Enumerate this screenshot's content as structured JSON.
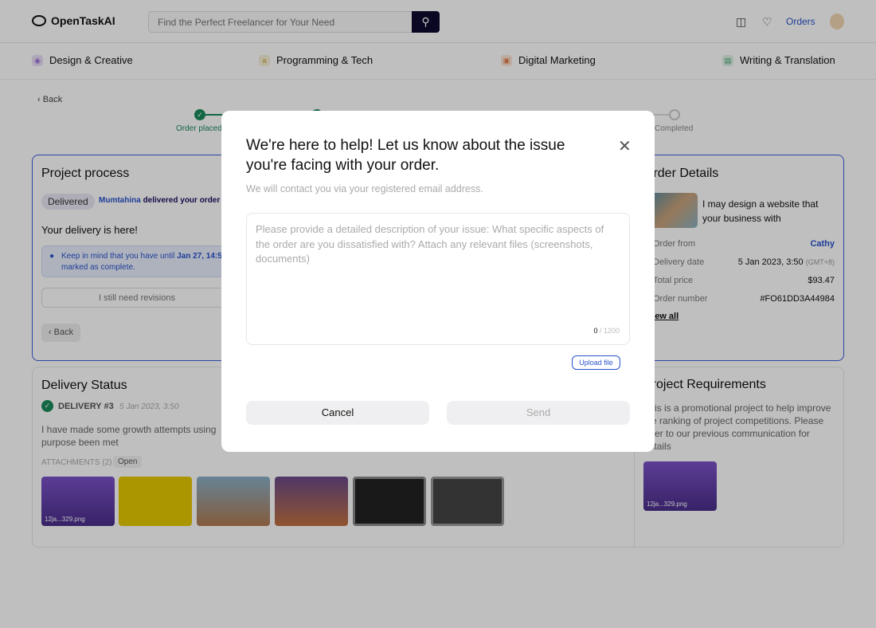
{
  "header": {
    "logo": "OpenTaskAI",
    "search_placeholder": "Find the Perfect Freelancer for Your Need",
    "orders": "Orders"
  },
  "categories": [
    {
      "label": "Design & Creative",
      "icon": "palette-icon",
      "color": "#9b6fd6"
    },
    {
      "label": "Programming & Tech",
      "icon": "code-icon",
      "color": "#c8a020"
    },
    {
      "label": "Digital Marketing",
      "icon": "briefcase-icon",
      "color": "#e07a40"
    },
    {
      "label": "Writing & Translation",
      "icon": "document-icon",
      "color": "#40a070"
    }
  ],
  "back": "Back",
  "stepper": {
    "first": "Order placed",
    "last": "Completed"
  },
  "project": {
    "title": "Project process",
    "status": "Delivered",
    "seller": "Mumtahina",
    "delivered_text": "delivered your order",
    "delivery_heading": "Your delivery is here!",
    "info_pre": "Keep in mind that you have until ",
    "info_date": "Jan 27, 14:5",
    "info_post": "marked as complete.",
    "revisions": "I still need revisions",
    "back": "Back"
  },
  "order": {
    "title": "Order Details",
    "gig": "I may design a website that your business with",
    "rows": [
      {
        "label": "Order from",
        "value": "Cathy"
      },
      {
        "label": "Delivery date",
        "value": "5 Jan 2023, 3:50",
        "suffix": "(GMT+8)"
      },
      {
        "label": "Total price",
        "value": "$93.47"
      },
      {
        "label": "Order number",
        "value": "#FO61DD3A44984"
      }
    ],
    "view_all": "View all"
  },
  "delivery": {
    "title": "Delivery Status",
    "label": "DELIVERY #3",
    "date": "5 Jan 2023, 3:50",
    "text": "I have made some growth attempts using",
    "text2": "purpose been met",
    "attachments": "ATTACHMENTS (2)",
    "open": "Open",
    "file": "12ja...329.png"
  },
  "requirements": {
    "title": "Project Requirements",
    "text": "This is a promotional project to help improve the ranking of project competitions. Please refer to our previous communication for details",
    "file": "12ja...329.png"
  },
  "modal": {
    "title": "We're here to help! Let us know about the issue you're facing with your order.",
    "subtitle": "We will contact you via your registered email address.",
    "placeholder": "Please provide a detailed description of your issue: What specific aspects of the order are you dissatisfied with? Attach any relevant files (screenshots, documents)",
    "count": "0",
    "max": "/ 1200",
    "upload": "Upload file",
    "cancel": "Cancel",
    "send": "Send"
  }
}
